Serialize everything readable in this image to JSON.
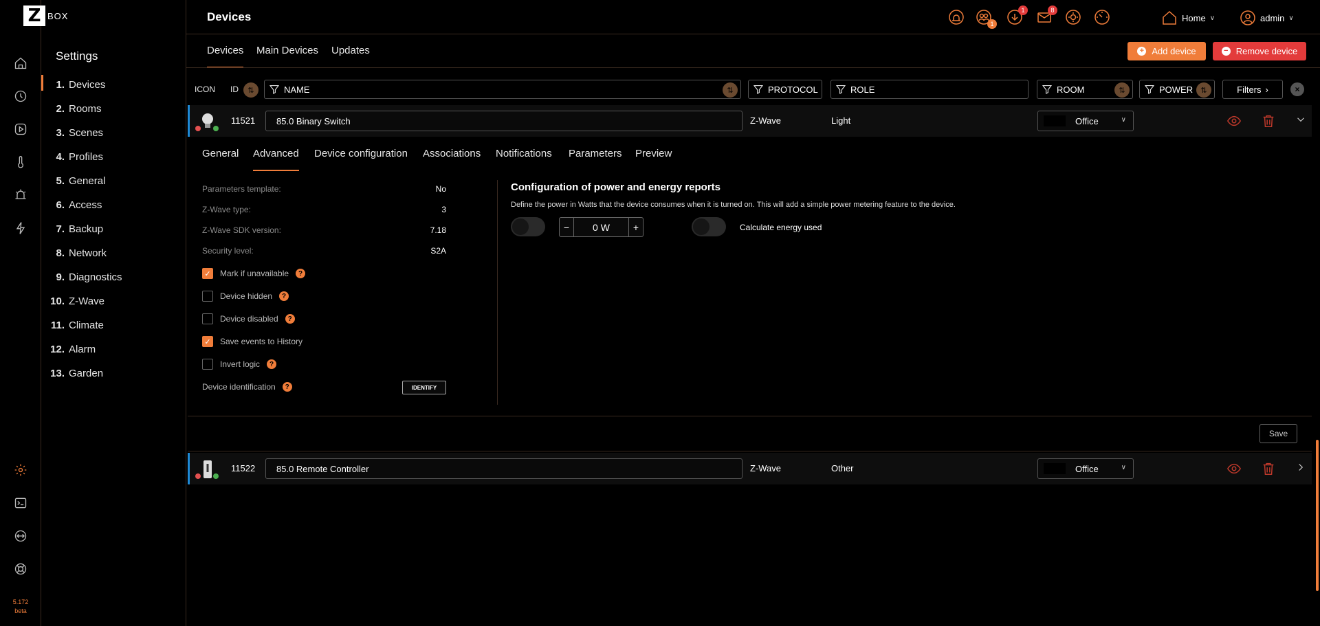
{
  "brand": {
    "logo_letter": "Z",
    "logo_text": "BOX"
  },
  "version": {
    "line1": "5.172",
    "line2": "beta"
  },
  "colors": {
    "accent": "#f07d3a",
    "danger": "#e33b3b",
    "selection": "#1e8ad6"
  },
  "rail_icons": [
    "home-icon",
    "clock-icon",
    "play-icon",
    "thermometer-icon",
    "alarm-icon",
    "lightning-icon",
    "gear-icon",
    "terminal-icon",
    "link-icon",
    "lifebuoy-icon"
  ],
  "settings": {
    "title": "Settings",
    "items": [
      {
        "num": "1.",
        "label": "Devices"
      },
      {
        "num": "2.",
        "label": "Rooms"
      },
      {
        "num": "3.",
        "label": "Scenes"
      },
      {
        "num": "4.",
        "label": "Profiles"
      },
      {
        "num": "5.",
        "label": "General"
      },
      {
        "num": "6.",
        "label": "Access"
      },
      {
        "num": "7.",
        "label": "Backup"
      },
      {
        "num": "8.",
        "label": "Network"
      },
      {
        "num": "9.",
        "label": "Diagnostics"
      },
      {
        "num": "10.",
        "label": "Z-Wave"
      },
      {
        "num": "11.",
        "label": "Climate"
      },
      {
        "num": "12.",
        "label": "Alarm"
      },
      {
        "num": "13.",
        "label": "Garden"
      }
    ]
  },
  "header": {
    "title": "Devices",
    "badges": {
      "users": "1",
      "download": "1",
      "mail": "8"
    },
    "home": "Home",
    "user": "admin"
  },
  "tabs": {
    "devices": "Devices",
    "main_devices": "Main Devices",
    "updates": "Updates"
  },
  "actions": {
    "add": "Add device",
    "remove": "Remove device",
    "add_glyph": "+",
    "remove_glyph": "−"
  },
  "filters": {
    "icon": "ICON",
    "id": "ID",
    "name": "NAME",
    "protocol": "PROTOCOL",
    "role": "ROLE",
    "room": "ROOM",
    "power": "POWER",
    "filters": "Filters"
  },
  "devices": [
    {
      "id": "11521",
      "name": "85.0 Binary Switch",
      "protocol": "Z-Wave",
      "role": "Light",
      "room": "Office"
    },
    {
      "id": "11522",
      "name": "85.0 Remote Controller",
      "protocol": "Z-Wave",
      "role": "Other",
      "room": "Office"
    }
  ],
  "device_tabs": {
    "general": "General",
    "advanced": "Advanced",
    "device_configuration": "Device configuration",
    "associations": "Associations",
    "notifications": "Notifications",
    "parameters": "Parameters",
    "preview": "Preview"
  },
  "advanced": {
    "info": [
      {
        "label": "Parameters template:",
        "value": "No"
      },
      {
        "label": "Z-Wave type:",
        "value": "3"
      },
      {
        "label": "Z-Wave SDK version:",
        "value": "7.18"
      },
      {
        "label": "Security level:",
        "value": "S2A"
      }
    ],
    "checks": [
      {
        "label": "Mark if unavailable",
        "checked": true,
        "help": true
      },
      {
        "label": "Device hidden",
        "checked": false,
        "help": true
      },
      {
        "label": "Device disabled",
        "checked": false,
        "help": true
      },
      {
        "label": "Save events to History",
        "checked": true,
        "help": false
      },
      {
        "label": "Invert logic",
        "checked": false,
        "help": true
      }
    ],
    "identification_label": "Device identification",
    "identify_button": "IDENTIFY",
    "help_glyph": "?",
    "check_glyph": "✓"
  },
  "power_config": {
    "title": "Configuration of power and energy reports",
    "description": "Define the power in Watts that the device consumes when it is turned on. This will add a simple power metering feature to the device.",
    "value": "0 W",
    "minus": "−",
    "plus": "+",
    "calc_label": "Calculate energy used",
    "power_enabled": false,
    "calc_enabled": false
  },
  "save": "Save"
}
